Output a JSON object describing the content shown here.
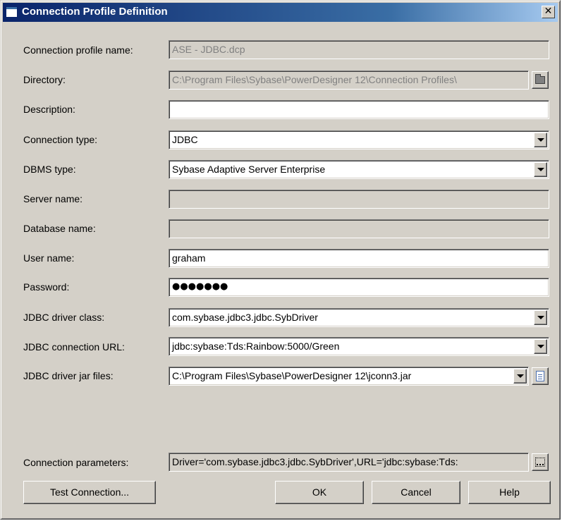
{
  "window": {
    "title": "Connection Profile Definition",
    "close_glyph": "✕"
  },
  "fields": {
    "profile_name": {
      "label": "Connection profile name:",
      "value": "ASE - JDBC.dcp"
    },
    "directory": {
      "label": "Directory:",
      "value": "C:\\Program Files\\Sybase\\PowerDesigner 12\\Connection Profiles\\"
    },
    "description": {
      "label": "Description:",
      "value": ""
    },
    "connection_type": {
      "label": "Connection type:",
      "value": "JDBC"
    },
    "dbms_type": {
      "label": "DBMS type:",
      "value": "Sybase Adaptive Server Enterprise"
    },
    "server_name": {
      "label": "Server name:",
      "value": ""
    },
    "database_name": {
      "label": "Database name:",
      "value": ""
    },
    "user_name": {
      "label": "User name:",
      "value": "graham"
    },
    "password": {
      "label": "Password:",
      "value": "●●●●●●●"
    },
    "jdbc_driver_class": {
      "label": "JDBC driver class:",
      "value": "com.sybase.jdbc3.jdbc.SybDriver"
    },
    "jdbc_connection_url": {
      "label": "JDBC connection URL:",
      "value": "jdbc:sybase:Tds:Rainbow:5000/Green"
    },
    "jdbc_driver_jar": {
      "label": "JDBC driver jar files:",
      "value": "C:\\Program Files\\Sybase\\PowerDesigner 12\\jconn3.jar"
    },
    "connection_parameters": {
      "label": "Connection parameters:",
      "value": "Driver='com.sybase.jdbc3.jdbc.SybDriver',URL='jdbc:sybase:Tds:"
    }
  },
  "buttons": {
    "test_connection": "Test Connection...",
    "ok": "OK",
    "cancel": "Cancel",
    "help": "Help"
  },
  "icons": {
    "folder": "folder-icon",
    "document": "document-icon",
    "ellipsis": "ellipsis-icon",
    "dropdown": "chevron-down-icon"
  },
  "colors": {
    "face": "#d4d0c8",
    "title_start": "#0a246a",
    "title_end": "#a6caf0",
    "disabled_text": "#808080"
  }
}
